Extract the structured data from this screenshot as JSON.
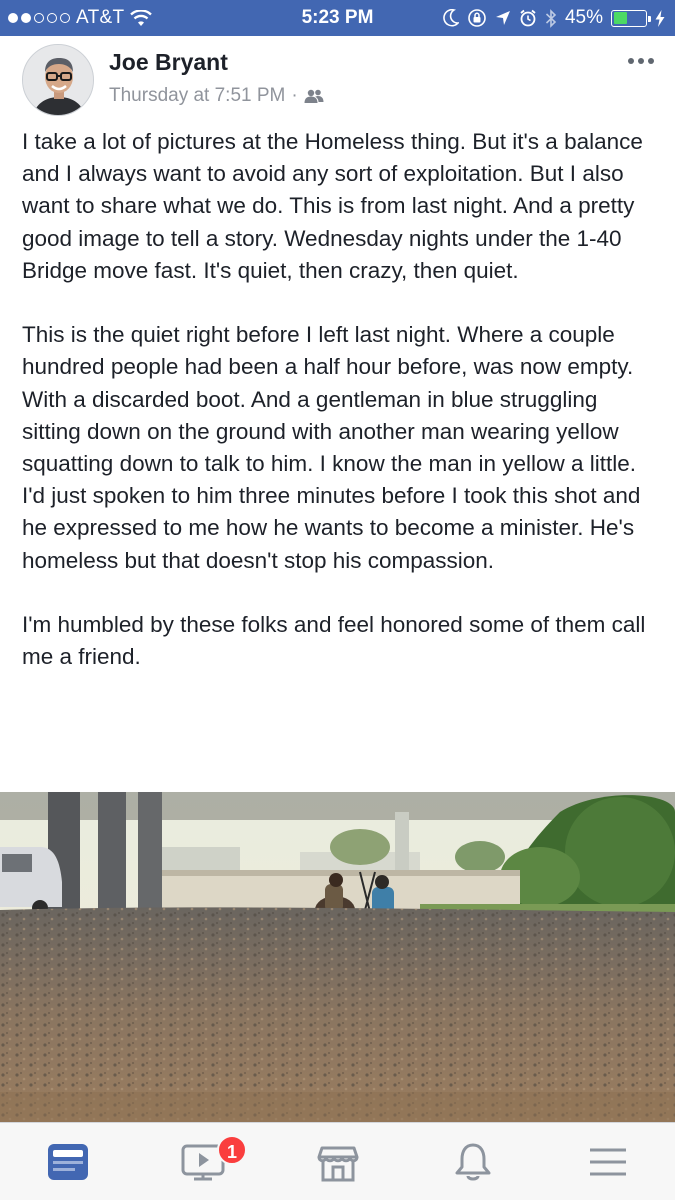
{
  "status_bar": {
    "carrier": "AT&T",
    "time": "5:23 PM",
    "battery_percent": "45%",
    "battery_level": 0.45,
    "icons": [
      "wifi-icon",
      "moon-icon",
      "orientation-lock-icon",
      "location-icon",
      "alarm-icon",
      "bluetooth-icon",
      "charging-icon"
    ]
  },
  "post": {
    "author": "Joe Bryant",
    "timestamp": "Thursday at 7:51 PM",
    "separator": "·",
    "audience_icon": "friends-icon",
    "paragraphs": [
      "I take a lot of pictures at the Homeless thing. But it's a balance and I always want to avoid any sort of exploitation. But I also want to share what we do. This is from last night. And a pretty good image to tell a story. Wednesday nights under the 1-40 Bridge move fast. It's quiet, then crazy, then quiet.",
      "This is the quiet right before I left last night. Where a couple hundred people had been a half hour before, was now empty. With a discarded boot. And a gentleman in blue struggling sitting down on the ground with another man wearing yellow squatting down to talk to him. I know the man in yellow a little. I'd just spoken to him three minutes before I took this shot and he expressed to me how he wants to become a minister. He's homeless but that doesn't stop his compassion.",
      "I'm humbled by these folks and feel honored some of them call me a friend."
    ]
  },
  "tab_bar": {
    "tabs": [
      {
        "icon": "news-feed-icon",
        "active": true
      },
      {
        "icon": "video-icon",
        "badge": "1"
      },
      {
        "icon": "marketplace-icon"
      },
      {
        "icon": "notifications-bell-icon"
      },
      {
        "icon": "menu-icon"
      }
    ]
  },
  "colors": {
    "brand_blue": "#4267b2",
    "active_tab": "#4267b2",
    "inactive_tab": "#8d949e",
    "badge_red": "#fa3e3e",
    "battery_green": "#4cd964"
  }
}
